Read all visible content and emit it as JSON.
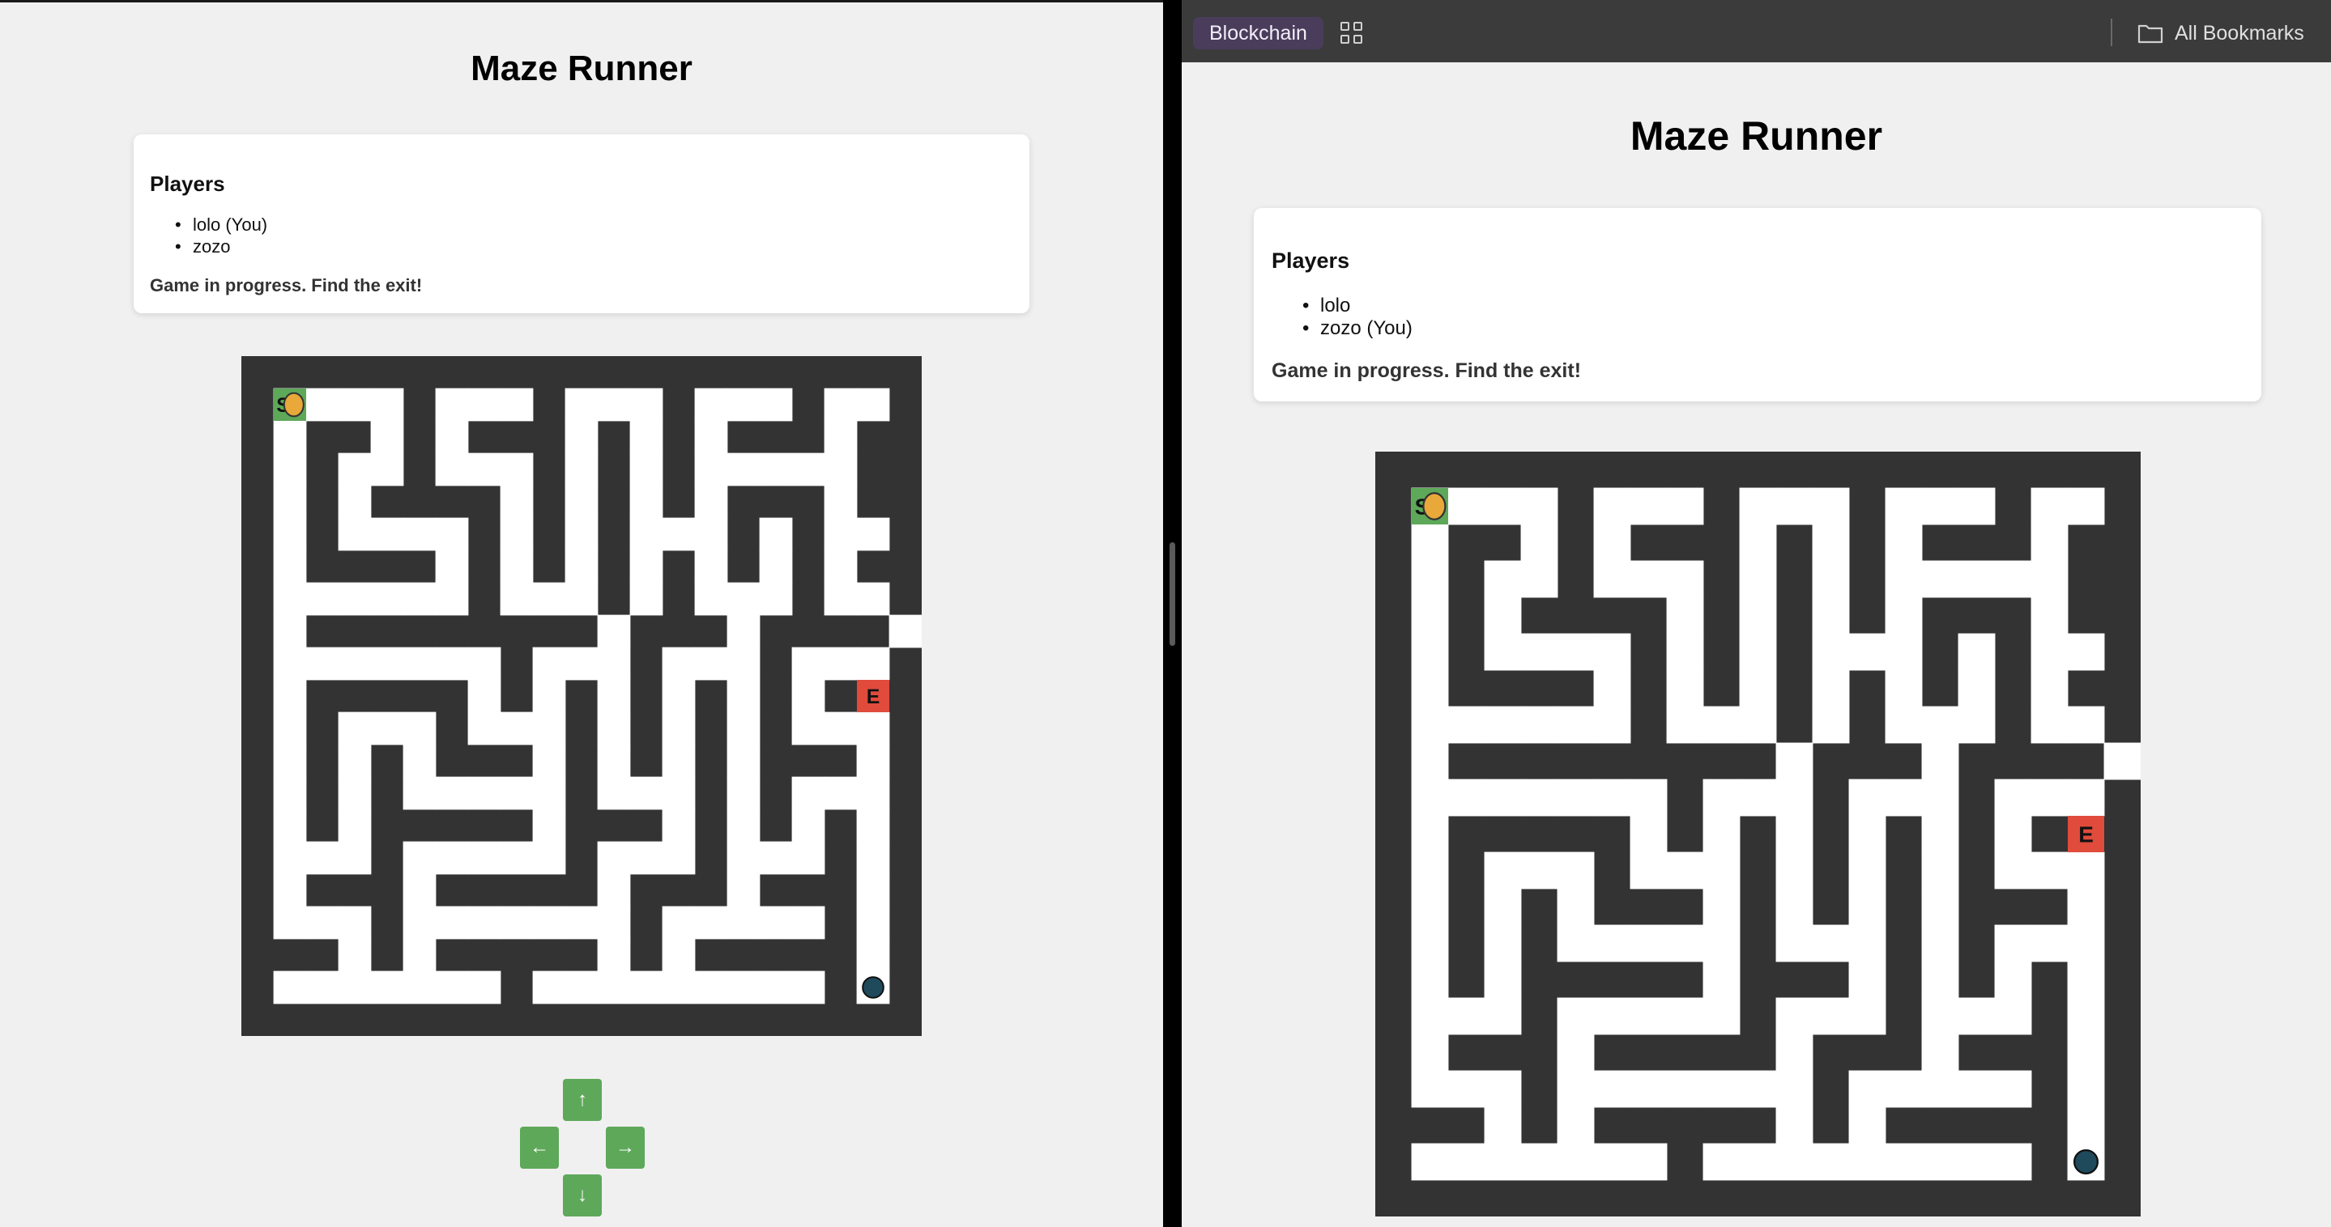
{
  "left": {
    "title": "Maze Runner",
    "players_heading": "Players",
    "players": [
      "lolo (You)",
      "zozo"
    ],
    "status": "Game in progress. Find the exit!",
    "controls": {
      "up": "↑",
      "left": "←",
      "right": "→",
      "down": "↓"
    }
  },
  "right": {
    "bookmarks": {
      "folder_chip": "Blockchain",
      "apps_icon": "grid-icon",
      "all_bookmarks": "All Bookmarks",
      "folder_icon": "folder-icon"
    },
    "title": "Maze Runner",
    "players_heading": "Players",
    "players": [
      "lolo",
      "zozo (You)"
    ],
    "status": "Game in progress. Find the exit!"
  },
  "maze": {
    "start_label": "S",
    "exit_label": "E",
    "colors": {
      "wall": "#333333",
      "path": "#ffffff",
      "start": "#5ea85a",
      "exit": "#e04b3c",
      "player_you": "#e8a83a",
      "player_other": "#1f4a5c",
      "control": "#5ea85a"
    }
  }
}
